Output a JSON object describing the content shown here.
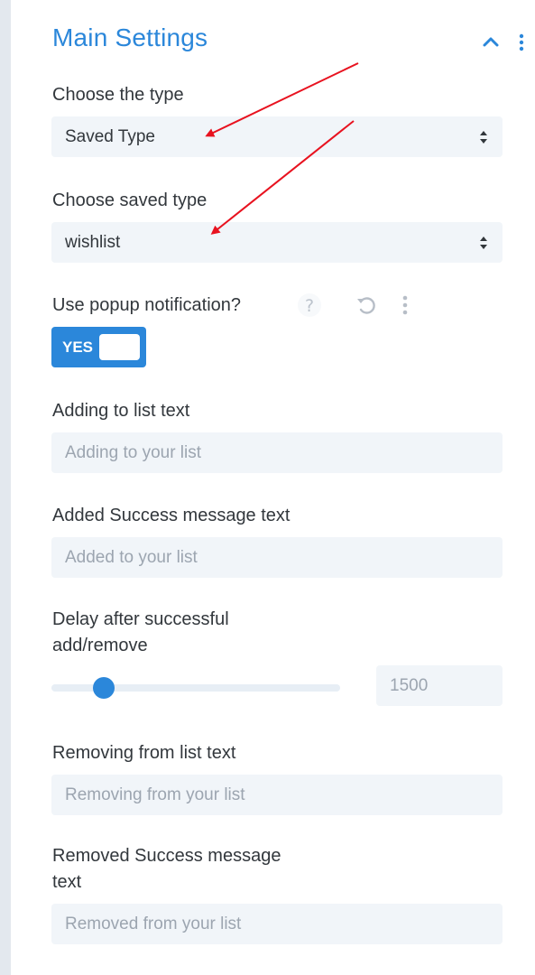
{
  "panel": {
    "title": "Main Settings",
    "collapse_icon": "chevron-up-icon",
    "options_icon": "kebab-icon"
  },
  "fields": {
    "type_label": "Choose the type",
    "type_value": "Saved Type",
    "saved_type_label": "Choose saved type",
    "saved_type_value": "wishlist",
    "popup_label": "Use popup notification?",
    "popup_toggle_label": "YES",
    "adding_label": "Adding to list text",
    "adding_placeholder": "Adding to your list",
    "added_label": "Added Success message text",
    "added_placeholder": "Added to your list",
    "delay_label_line1": "Delay after successful",
    "delay_label_line2": "add/remove",
    "delay_value": "1500",
    "delay_slider_fraction": 0.18,
    "removing_label": "Removing from list text",
    "removing_placeholder": "Removing from your list",
    "removed_label_line1": "Removed Success message",
    "removed_label_line2": "text",
    "removed_placeholder": "Removed from your list"
  },
  "colors": {
    "accent": "#2b87da",
    "annotation_arrow": "#e8121f",
    "field_bg": "#f1f5f9"
  },
  "icons": [
    "chevron-up-icon",
    "kebab-icon",
    "select-arrows-icon",
    "help-icon",
    "reset-icon",
    "more-icon"
  ]
}
